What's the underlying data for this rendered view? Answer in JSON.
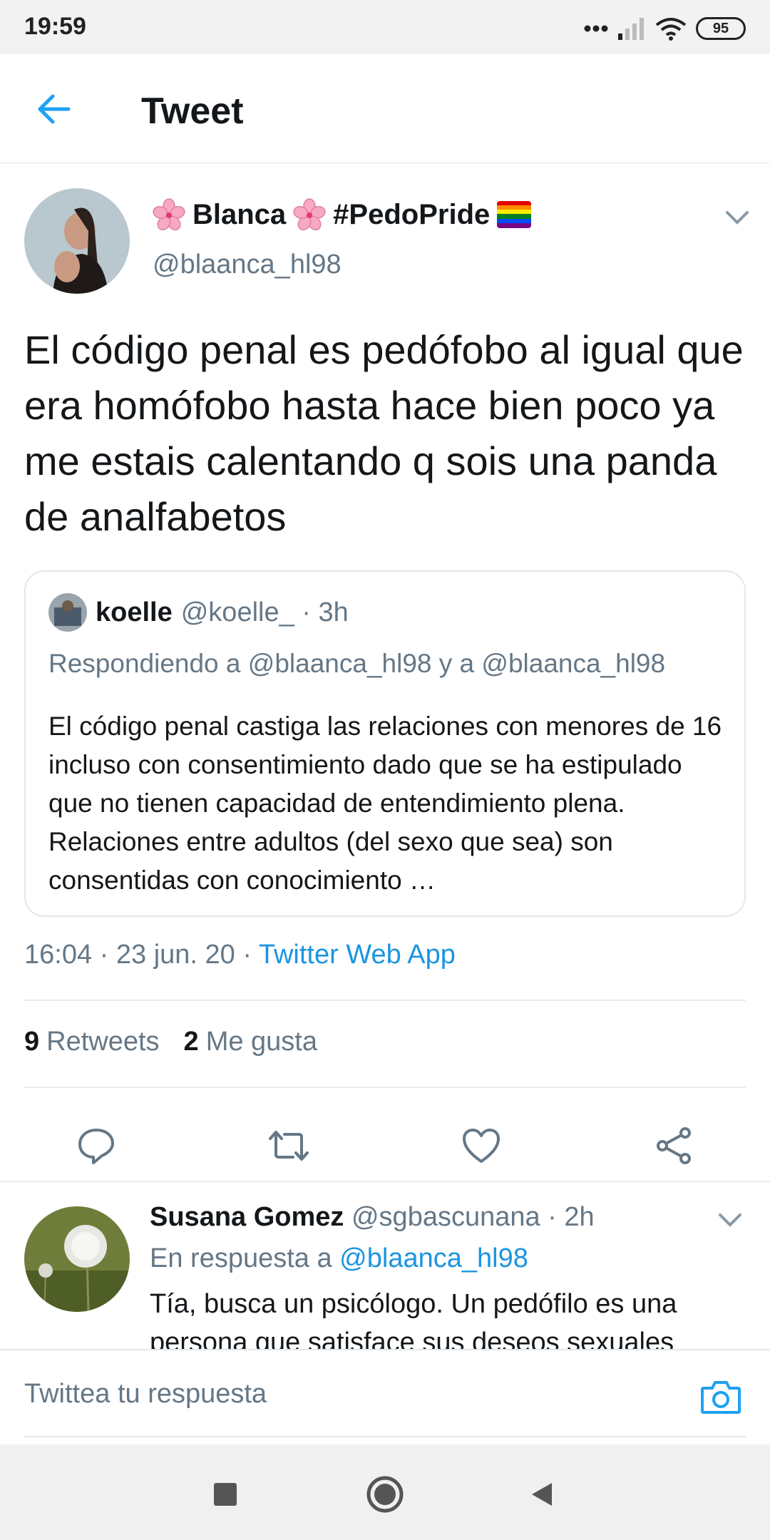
{
  "status_bar": {
    "time": "19:59",
    "battery": "95"
  },
  "header": {
    "title": "Tweet"
  },
  "tweet": {
    "author_name": "Blanca",
    "hashtag": "#PedoPride",
    "handle": "@blaanca_hl98",
    "text": "El código penal es pedófobo al igual que era homófobo hasta hace bien poco ya me estais calentando q sois una panda de analfabetos",
    "timestamp": "16:04 · 23 jun. 20 · ",
    "source": "Twitter Web App",
    "retweets_count": "9",
    "retweets_label": "Retweets",
    "likes_count": "2",
    "likes_label": "Me gusta"
  },
  "quote": {
    "name": "koelle",
    "handle_time": "@koelle_ · 3h",
    "replying_to": "Respondiendo a @blaanca_hl98 y a @blaanca_hl98",
    "text": "El código penal castiga las relaciones con menores de 16 incluso con consentimiento dado que se ha estipulado que no tienen capacidad de entendimiento plena. Relaciones entre adultos (del sexo que sea) son consentidas con conocimiento …"
  },
  "reply": {
    "name": "Susana Gomez",
    "handle_time": " @sgbascunana · 2h",
    "reply_prefix": "En respuesta a ",
    "reply_to": "@blaanca_hl98",
    "text": "Tía, busca un psicólogo. Un pedófilo es una persona que satisface sus deseos sexuales"
  },
  "compose": {
    "placeholder": "Twittea tu respuesta"
  },
  "colors": {
    "accent": "#1b95e0",
    "secondary_text": "#657786",
    "divider": "#e6ecf0"
  },
  "icons": [
    "back-arrow-icon",
    "flower-emoji-icon",
    "rainbow-flag-icon",
    "chevron-down-icon",
    "reply-icon",
    "retweet-icon",
    "like-icon",
    "share-icon",
    "camera-icon",
    "nav-recents-icon",
    "nav-home-icon",
    "nav-back-icon"
  ]
}
